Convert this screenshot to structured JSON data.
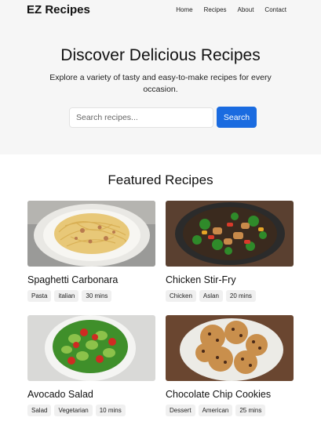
{
  "header": {
    "logo": "EZ Recipes",
    "nav": [
      "Home",
      "Recipes",
      "About",
      "Contact"
    ]
  },
  "hero": {
    "title": "Discover Delicious Recipes",
    "subtitle": "Explore a variety of tasty and easy-to-make recipes for every occasion.",
    "search_placeholder": "Search recipes...",
    "search_button": "Search"
  },
  "featured": {
    "title": "Featured Recipes",
    "recipes": [
      {
        "name": "Spaghetti Carbonara",
        "tags": [
          "Pasta",
          "italian",
          "30 mins"
        ],
        "image": "spaghetti-image"
      },
      {
        "name": "Chicken Stir-Fry",
        "tags": [
          "Chicken",
          "Aslan",
          "20 mins"
        ],
        "image": "stirfry-image"
      },
      {
        "name": "Avocado Salad",
        "tags": [
          "Salad",
          "Vegetarian",
          "10 mins"
        ],
        "image": "salad-image"
      },
      {
        "name": "Chocolate Chip Cookies",
        "tags": [
          "Dessert",
          "American",
          "25 mins"
        ],
        "image": "cookies-image"
      }
    ]
  },
  "colors": {
    "accent": "#1a6be0",
    "hero_bg": "#f6f6f6"
  }
}
